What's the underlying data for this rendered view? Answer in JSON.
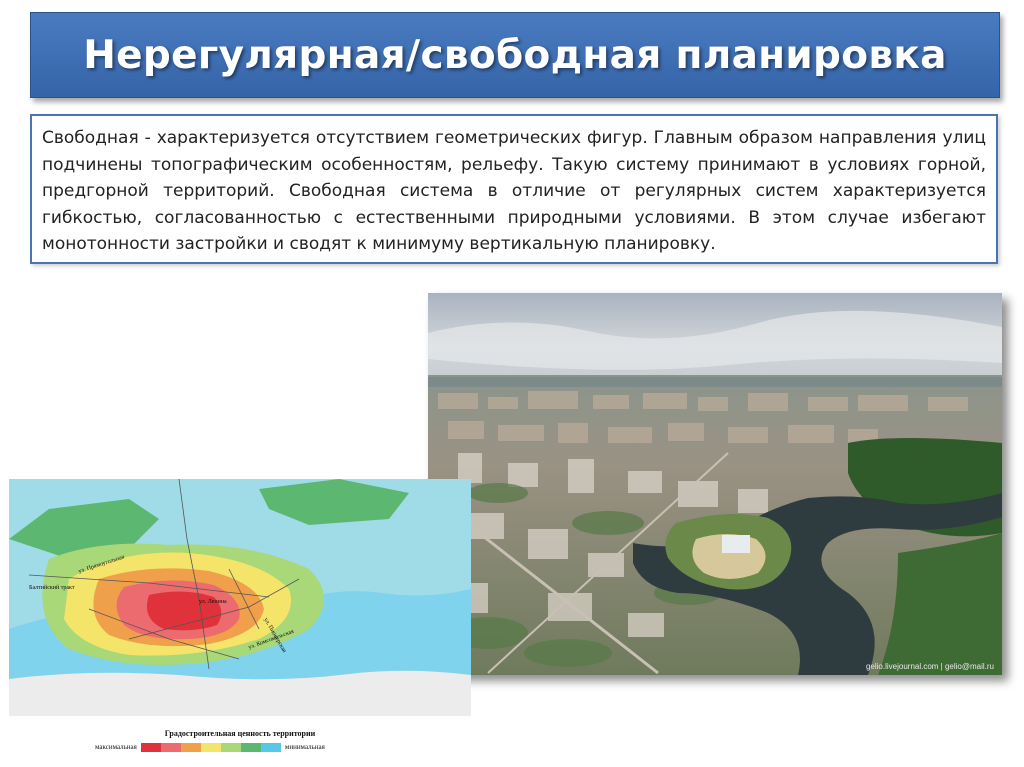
{
  "slide": {
    "title": "Нерегулярная/свободная планировка",
    "body": "Свободная - характеризуется отсутствием геометрических фигур. Главным образом направления улиц подчинены топографическим особенностям, рельефу. Такую систему принимают в условиях горной, предгорной территорий. Свободная система в отличие от регулярных систем характеризуется гибкостью, согласованностью с естественными природными условиями. В этом случае избегают монотонности застройки и сводят к минимуму вертикальную планировку."
  },
  "photo": {
    "credit": "gelio.livejournal.com | gelio@mail.ru"
  },
  "map": {
    "street_labels": [
      "ул. Прямоугольная",
      "Балтийский тракт",
      "ул. Ленина",
      "ул. Пионерская",
      "ул. Комсомольская"
    ],
    "legend": {
      "title": "Градостроительная ценность территории",
      "max_label": "максимальная",
      "min_label": "минимальная",
      "colors": [
        "#e0323a",
        "#ec6b6f",
        "#f0a04a",
        "#f4e46a",
        "#a8d878",
        "#5cb870",
        "#58c8e8"
      ]
    }
  }
}
